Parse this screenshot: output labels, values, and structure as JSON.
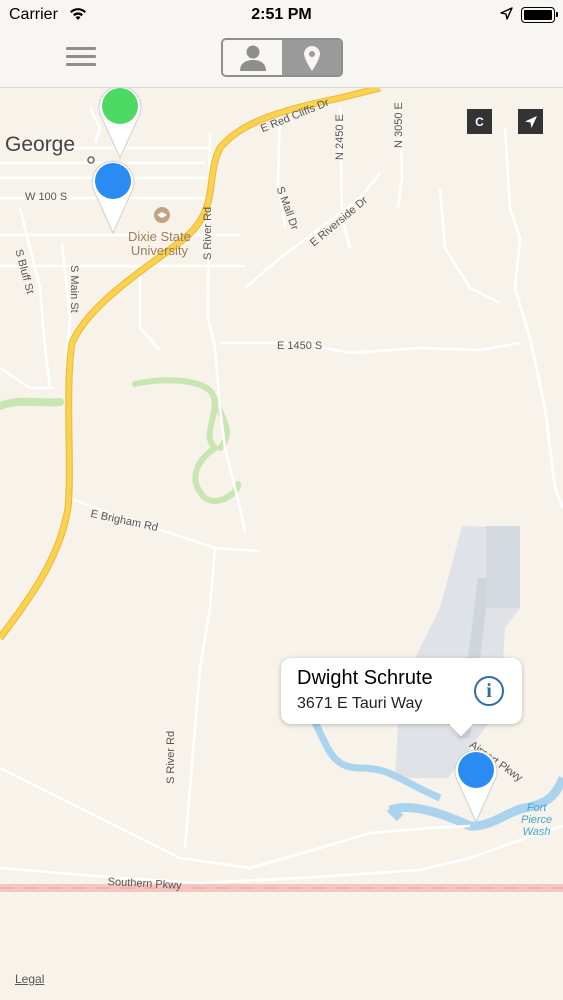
{
  "status_bar": {
    "carrier": "Carrier",
    "time": "2:51 PM"
  },
  "nav": {
    "menu_icon": "hamburger-menu-icon",
    "segments": [
      {
        "icon": "person-icon",
        "selected": false
      },
      {
        "icon": "map-pin-icon",
        "selected": true
      }
    ]
  },
  "map": {
    "controls": {
      "compass_button": "C",
      "location_button_icon": "location-arrow-icon"
    },
    "labels": {
      "city": "George",
      "w100s": "W 100 S",
      "university": "Dixie State\nUniversity",
      "s_bluff": "S Bluff St",
      "s_main": "S Main St",
      "s_river_top": "S River Rd",
      "e_red_cliffs": "E Red Cliffs Dr",
      "n2450e": "N 2450 E",
      "n3050e": "N 3050 E",
      "s_mall": "S Mall Dr",
      "e_riverside": "E Riverside Dr",
      "e1450s": "E 1450 S",
      "e_brigham": "E Brigham Rd",
      "s_river_bottom": "S River Rd",
      "airport_pkwy": "Airport Pkwy",
      "fort_pierce": "Fort\nPierce\nWash",
      "southern_pkwy": "Southern Pkwy"
    },
    "pins": [
      {
        "color": "#4cd964",
        "name": "green-pin"
      },
      {
        "color": "#2a8cf3",
        "name": "blue-pin-top"
      },
      {
        "color": "#2a8cf3",
        "name": "blue-pin-selected"
      }
    ],
    "callout": {
      "name": "Dwight Schrute",
      "address": "3671 E Tauri Way",
      "info_icon": "info-icon"
    },
    "legal": "Legal"
  }
}
